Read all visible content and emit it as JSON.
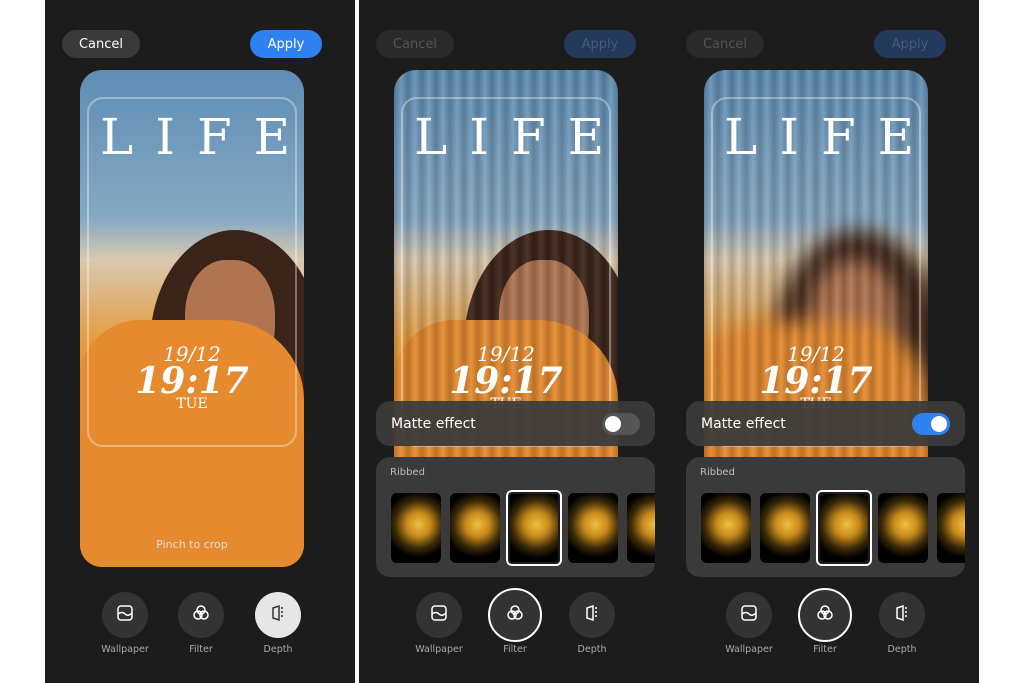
{
  "actions": {
    "cancel": "Cancel",
    "apply": "Apply"
  },
  "lockscreen": {
    "title": "LIFE",
    "date": "19/12",
    "time": "19:17",
    "day": "TUE"
  },
  "hint": "Pinch to crop",
  "matte": {
    "label": "Matte effect"
  },
  "filter_section": "Ribbed",
  "tools": [
    "Wallpaper",
    "Filter",
    "Depth"
  ],
  "panels": [
    {
      "mode": "depth",
      "matte_on": null
    },
    {
      "mode": "filter",
      "matte_on": false,
      "selected_filter": 3
    },
    {
      "mode": "filter",
      "matte_on": true,
      "selected_filter": 3
    }
  ],
  "colors": {
    "accent": "#2f80f0",
    "background": "#1c1c1c"
  }
}
